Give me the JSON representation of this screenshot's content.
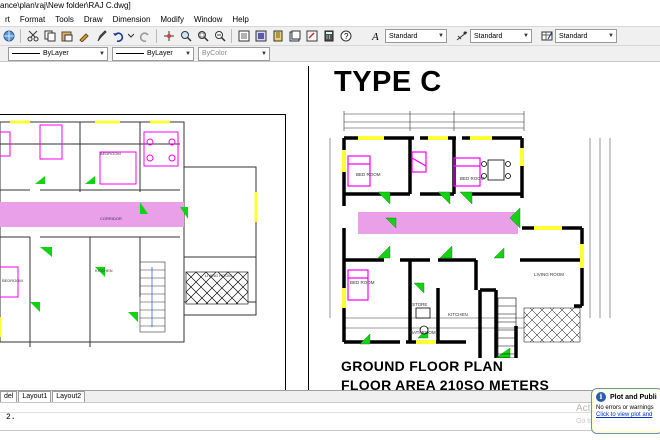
{
  "window": {
    "title": "ance\\plan\\raj\\New folder\\RAJ C.dwg]"
  },
  "menu": [
    {
      "label": "rt"
    },
    {
      "label": "Format"
    },
    {
      "label": "Tools"
    },
    {
      "label": "Draw"
    },
    {
      "label": "Dimension"
    },
    {
      "label": "Modify"
    },
    {
      "label": "Window"
    },
    {
      "label": "Help"
    }
  ],
  "styles_toolbar": {
    "text_style": "Standard",
    "dim_style": "Standard",
    "table_style": "Standard"
  },
  "properties_toolbar": {
    "linetype": "ByLayer",
    "lineweight": "ByLayer",
    "plotstyle": "ByColor"
  },
  "drawing": {
    "type_title": "TYPE C",
    "plan_title": "GROUND FLOOR PLAN",
    "area_title": "FLOOR AREA 210SQ METERS",
    "right_rooms": {
      "bed1": "BED ROOM",
      "bed2": "BED ROOM",
      "bed3": "BED ROOM",
      "living": "LIVING ROOM",
      "store": "STORE",
      "kitchen": "KITCHEN",
      "bath": "BATHROOM"
    },
    "left_rooms": {
      "bedroom": "BEDROOM",
      "corridor": "CORRIDOR",
      "living": "LIVING ROOM",
      "kitchen": "KITCHEN",
      "bedroom2": "BEDROOM"
    }
  },
  "tabs": [
    {
      "label": "del"
    },
    {
      "label": "Layout1"
    },
    {
      "label": "Layout2"
    }
  ],
  "command": {
    "prompt": "2."
  },
  "watermark": {
    "line1": "Activ",
    "line2": "Go to"
  },
  "notification": {
    "title": "Plot and Publi",
    "message": "No errors or warnings",
    "link": "Click to view plot and"
  },
  "colors": {
    "toolbar_bg": "#f0f0f0",
    "corridor": "#e9a0e9",
    "green": "#12d312",
    "magenta": "#ff00ff",
    "yellow": "#ffff33"
  }
}
